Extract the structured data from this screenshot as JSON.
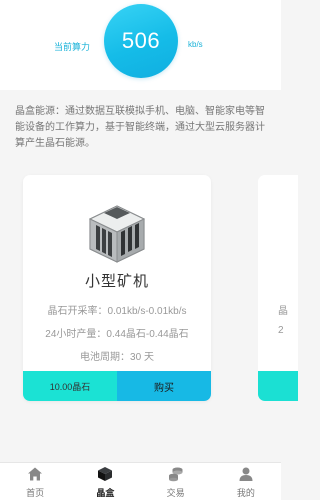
{
  "header": {
    "power_label": "当前算力",
    "power_value": "506",
    "power_unit": "kb/s",
    "accent": "#19b2d8"
  },
  "description": "晶盒能源：通过数据互联模拟手机、电脑、智能家电等智能设备的工作算力，基于智能终端，通过大型云服务器计算产生晶石能源。",
  "card": {
    "icon": "mining-machine-icon",
    "title": "小型矿机",
    "rate": "晶石开采率：0.01kb/s-0.01kb/s",
    "output": "24小时产量：0.44晶石-0.44晶石",
    "cycle": "电池周期：30 天",
    "price": "10.00晶石",
    "buy_label": "购买"
  },
  "peek_card": {
    "line1": "晶",
    "line2": "2"
  },
  "tabbar": {
    "items": [
      {
        "label": "首页",
        "icon": "home-icon"
      },
      {
        "label": "晶盒",
        "icon": "box-icon"
      },
      {
        "label": "交易",
        "icon": "coins-icon"
      },
      {
        "label": "我的",
        "icon": "user-icon"
      }
    ],
    "active": "晶盒"
  }
}
